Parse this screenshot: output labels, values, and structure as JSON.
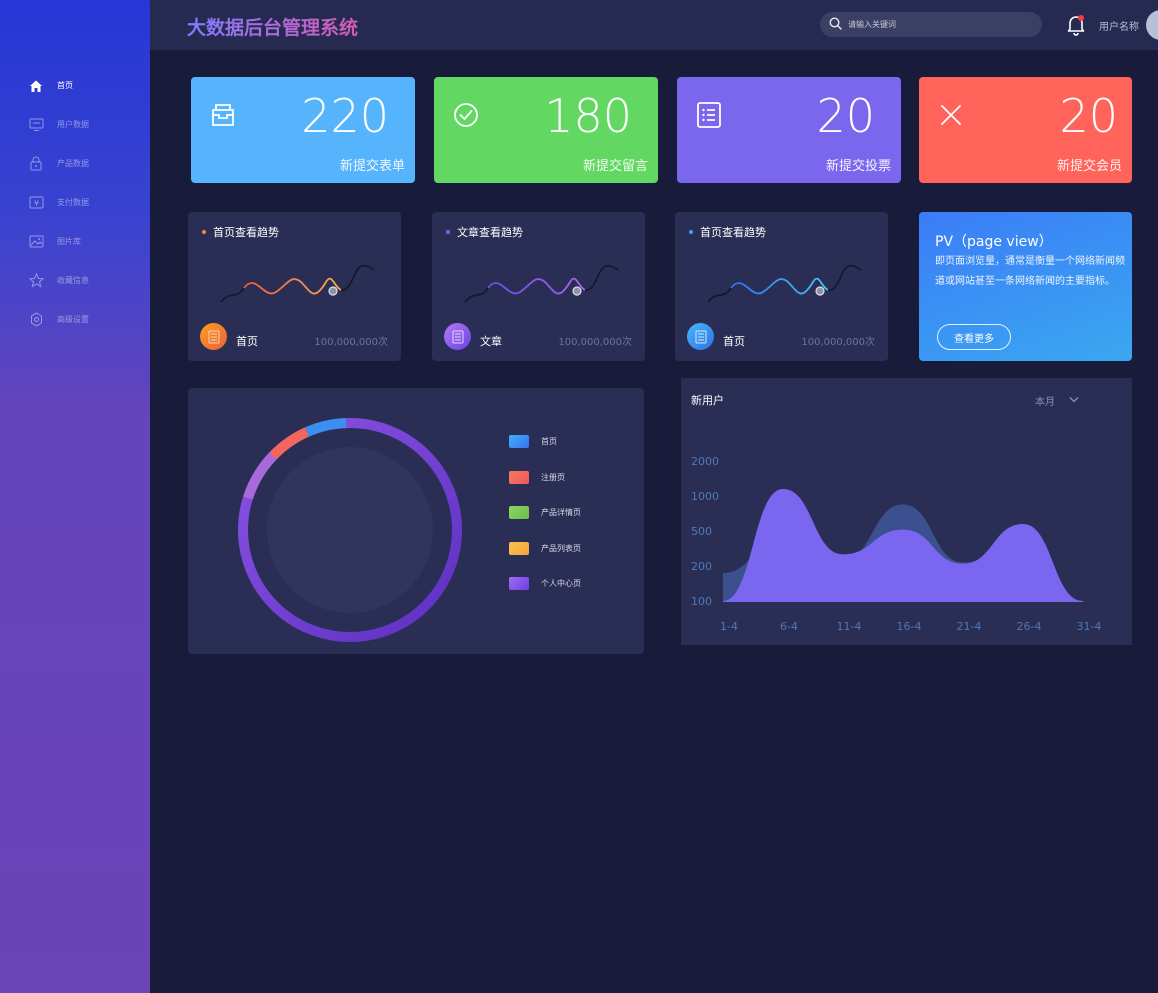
{
  "header": {
    "title": "大数据后台管理系统",
    "search_placeholder": "请输入关键词",
    "user_name": "用户名称",
    "bell_icon": "bell-icon"
  },
  "sidebar": {
    "items": [
      {
        "label": "首页",
        "icon": "home-icon",
        "active": true
      },
      {
        "label": "用户数据",
        "icon": "monitor-icon",
        "active": false
      },
      {
        "label": "产品数据",
        "icon": "lock-icon",
        "active": false
      },
      {
        "label": "支付数据",
        "icon": "yen-icon",
        "active": false
      },
      {
        "label": "图片库",
        "icon": "image-icon",
        "active": false
      },
      {
        "label": "收藏信息",
        "icon": "star-icon",
        "active": false
      },
      {
        "label": "高级设置",
        "icon": "settings-icon",
        "active": false
      }
    ]
  },
  "stats": [
    {
      "value": "220",
      "label": "新提交表单",
      "icon": "inbox-icon",
      "color": "#55b4fb"
    },
    {
      "value": "180",
      "label": "新提交留言",
      "icon": "check-circle-icon",
      "color": "#62d862"
    },
    {
      "value": "20",
      "label": "新提交投票",
      "icon": "list-icon",
      "color": "#7a67ee"
    },
    {
      "value": "20",
      "label": "新提交会员",
      "icon": "close-icon",
      "color": "#ff6359"
    }
  ],
  "trends": [
    {
      "title": "首页查看趋势",
      "name": "首页",
      "count": "100,000,000次",
      "accent": "#f08a3c"
    },
    {
      "title": "文章查看趋势",
      "name": "文章",
      "count": "100,000,000次",
      "accent": "#8a5cf2"
    },
    {
      "title": "首页查看趋势",
      "name": "首页",
      "count": "100,000,000次",
      "accent": "#3a9ef5"
    }
  ],
  "pv": {
    "title": "PV（page view）",
    "description": "即页面浏览量，通常是衡量一个网络新闻频道或网站甚至一条网络新闻的主要指标。",
    "button": "查看更多"
  },
  "donut": {
    "legend": [
      {
        "label": "首页",
        "color": "#3a8ff0"
      },
      {
        "label": "注册页",
        "color": "#f2665e"
      },
      {
        "label": "产品详情页",
        "color": "#7cc95b"
      },
      {
        "label": "产品列表页",
        "color": "#f4b444"
      },
      {
        "label": "个人中心页",
        "color": "#8a55ea"
      }
    ]
  },
  "new_users": {
    "title": "新用户",
    "period": "本月"
  },
  "chart_data": {
    "type": "area",
    "categories": [
      "1-4",
      "6-4",
      "11-4",
      "16-4",
      "21-4",
      "26-4",
      "31-4"
    ],
    "y_ticks": [
      "2000",
      "1000",
      "500",
      "200",
      "100"
    ],
    "series": [
      {
        "color": "#7b66f0",
        "values": [
          100,
          1200,
          300,
          520,
          220,
          600,
          100
        ]
      },
      {
        "color": "#3c4f8e",
        "values": [
          180,
          450,
          260,
          880,
          230,
          420,
          100
        ]
      }
    ]
  }
}
